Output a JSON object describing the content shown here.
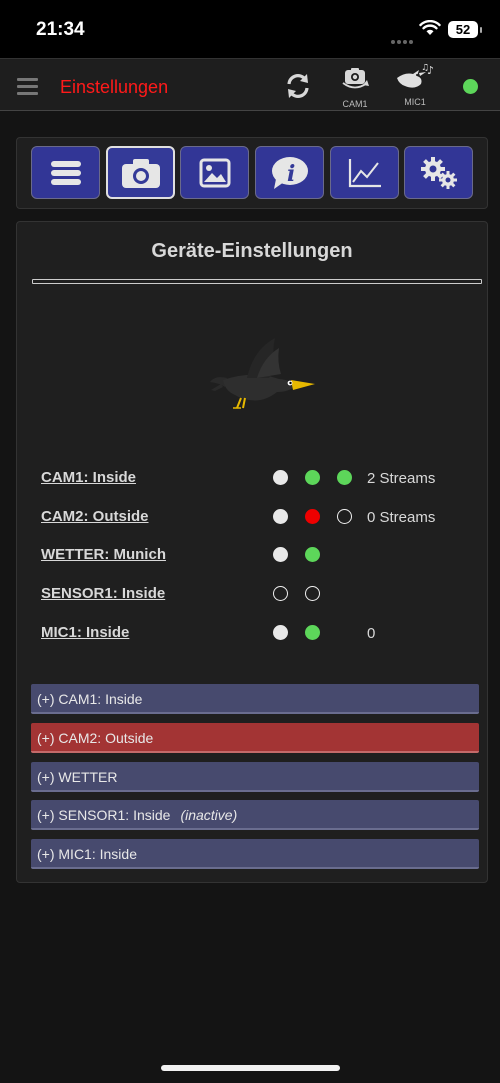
{
  "status_bar": {
    "time": "21:34",
    "battery": "52"
  },
  "header": {
    "title": "Einstellungen",
    "cam_label": "CAM1",
    "mic_label": "MIC1",
    "status_color": "#5dd65a"
  },
  "toolbar": {
    "buttons": [
      "menu-icon",
      "camera-icon",
      "image-icon",
      "info-icon",
      "chart-icon",
      "gears-icon"
    ],
    "active": "camera-icon"
  },
  "settings": {
    "title": "Geräte-Einstellungen",
    "devices": [
      {
        "name": "CAM1: Inside",
        "status": [
          "white",
          "green",
          "green"
        ],
        "extra": "2 Streams"
      },
      {
        "name": "CAM2: Outside",
        "status": [
          "white",
          "red",
          "empty"
        ],
        "extra": "0 Streams"
      },
      {
        "name": "WETTER: Munich",
        "status": [
          "white",
          "green"
        ],
        "extra": ""
      },
      {
        "name": "SENSOR1: Inside",
        "status": [
          "empty",
          "empty"
        ],
        "extra": ""
      },
      {
        "name": "MIC1: Inside",
        "status": [
          "white",
          "green"
        ],
        "extra": "0"
      }
    ],
    "sections": [
      {
        "label": "(+) CAM1: Inside",
        "note": "",
        "color": "#474a6e"
      },
      {
        "label": "(+) CAM2: Outside",
        "note": "",
        "color": "#a33434"
      },
      {
        "label": "(+) WETTER",
        "note": "",
        "color": "#474a6e"
      },
      {
        "label": "(+) SENSOR1: Inside",
        "note": "(inactive)",
        "color": "#474a6e"
      },
      {
        "label": "(+) MIC1: Inside",
        "note": "",
        "color": "#474a6e"
      }
    ]
  }
}
